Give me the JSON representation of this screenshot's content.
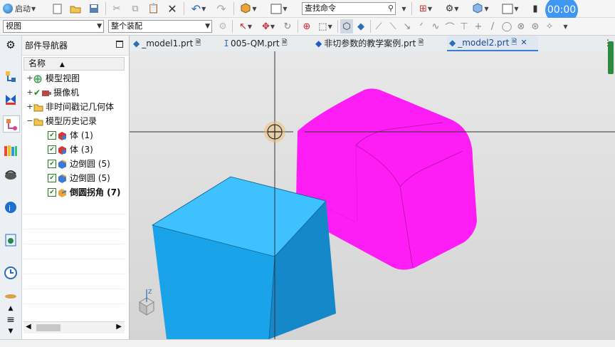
{
  "toolbar1": {
    "start_label": "启动",
    "search_placeholder": "查找命令"
  },
  "toolbar2": {
    "view_filter": "视图",
    "assembly_filter": "整个装配"
  },
  "navigator": {
    "title": "部件导航器",
    "column_header": "名称",
    "tree": [
      {
        "label": "模型视图",
        "expander": "+",
        "checked": false
      },
      {
        "label": "摄像机",
        "expander": "+",
        "checked": true
      },
      {
        "label": "非时间戳记几何体",
        "expander": "+",
        "checked": false
      },
      {
        "label": "模型历史记录",
        "expander": "−",
        "checked": false
      },
      {
        "label": "体 (1)",
        "checked": true
      },
      {
        "label": "体 (3)",
        "checked": true
      },
      {
        "label": "边倒圆 (5)",
        "checked": true
      },
      {
        "label": "边倒圆 (5)",
        "checked": true
      },
      {
        "label": "倒圆拐角 (7)",
        "checked": true,
        "bold": true
      }
    ]
  },
  "tabs": [
    {
      "label": "_model1.prt"
    },
    {
      "label": "005-QM.prt"
    },
    {
      "label": "非切参数的教学案例.prt"
    },
    {
      "label": "_model2.prt",
      "active": true
    }
  ],
  "timer": "00:00",
  "colors": {
    "magenta_body": "#ff1df5",
    "blue_body": "#1aa3e8",
    "accent": "#3a7bd5"
  }
}
